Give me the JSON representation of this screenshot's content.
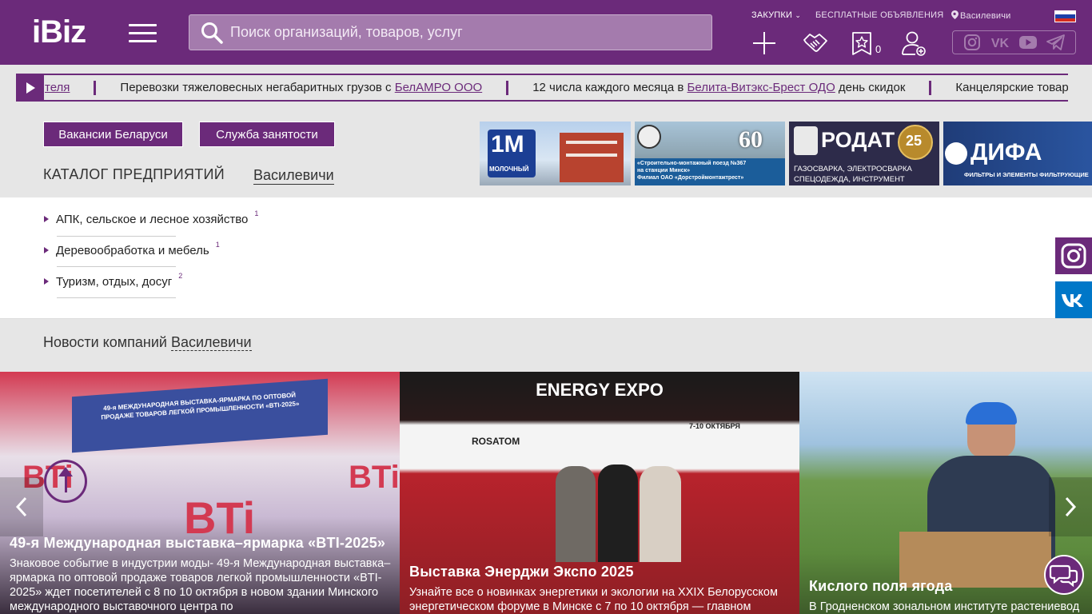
{
  "header": {
    "logo": "iBiz",
    "search_placeholder": "Поиск организаций, товаров, услуг",
    "zakupki": "ЗАКУПКИ",
    "free_ads": "БЕСПЛАТНЫЕ ОБЪЯВЛЕНИЯ",
    "location": "Василевичи",
    "favorites_count": "0",
    "colors": {
      "brand": "#6b2a7a"
    }
  },
  "ticker": {
    "items": [
      {
        "before": "",
        "link": "теля ",
        "after": ""
      },
      {
        "before": "Перевозки тяжеловесных негабаритных грузов с ",
        "link": "БелАМРО ООО",
        "after": ""
      },
      {
        "before": "12 числа каждого месяца в ",
        "link": "Белита-Витэкс-Брест ОДО",
        "after": " день скидок"
      },
      {
        "before": "Канцелярские товар",
        "link": "",
        "after": ""
      }
    ]
  },
  "buttons": {
    "vacancies": "Вакансии Беларуси",
    "employment": "Служба занятости"
  },
  "catalog": {
    "title": "КАТАЛОГ ПРЕДПРИЯТИЙ",
    "location": "Василевичи",
    "items": [
      {
        "label": "АПК, сельское и лесное хозяйство",
        "count": "1"
      },
      {
        "label": "Деревообработка и мебель",
        "count": "1"
      },
      {
        "label": "Туризм, отдых, досуг",
        "count": "2"
      }
    ]
  },
  "banners": {
    "b1_logo": "1M",
    "b1_text": "МОЛОЧНЫЙ",
    "b2_badge": "60",
    "b2_line1": "«Строительно-монтажный поезд №367",
    "b2_line2": "на станции Минск»",
    "b2_line3": "Филиал ОАО «Дорстроймонтажтрест»",
    "b3_title": "РОДАТ",
    "b3_badge": "25",
    "b3_line1": "ГАЗОСВАРКА, ЭЛЕКТРОСВАРКА",
    "b3_line2": "СПЕЦОДЕЖДА, ИНСТРУМЕНТ",
    "b4_title": "ДИФА",
    "b4_sub": "ФИЛЬТРЫ И ЭЛЕМЕНТЫ ФИЛЬТРУЮЩИЕ"
  },
  "news": {
    "title_prefix": "Новости компаний",
    "title_location": "Василевичи",
    "cards": [
      {
        "title": "49-я Международная выставка–ярмарка «BTI-2025»",
        "text": "Знаковое событие в индустрии моды- 49-я Международная выставка–ярмарка по оптовой продаже товаров легкой промышленности «BTI-2025» ждет посетителей с 8 по 10 октября в новом здании Минского международного выставочного центра по"
      },
      {
        "title": "Выставка Энерджи Экспо 2025",
        "text": "Узнайте все о новинках энергетики и экологии на XXIX Белорусском энергетическом форуме в Минске с 7 по 10 октября — главном"
      },
      {
        "title": "Кислого поля ягода",
        "text": "В Гродненском зональном институте растениевод"
      }
    ],
    "card1_banner": "49-я МЕЖДУНАРОДНАЯ ВЫСТАВКА-ЯРМАРКА ПО ОПТОВОЙ ПРОДАЖЕ ТОВАРОВ ЛЕГКОЙ ПРОМЫШЛЕННОСТИ «BTI-2025»",
    "card1_logo": "BTi",
    "card2_logo": "ENERGY EXPO",
    "card2_dates": "7-10 ОКТЯБРЯ",
    "card2_sponsor": "ROSATOM"
  }
}
